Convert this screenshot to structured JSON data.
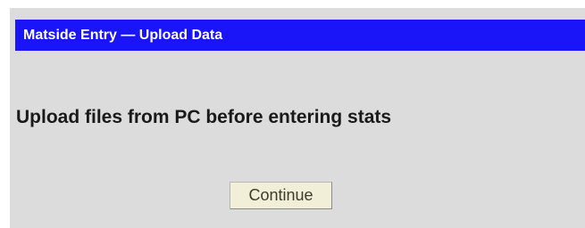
{
  "header": {
    "title": "Matside Entry — Upload Data"
  },
  "main": {
    "message": "Upload files from PC before entering stats",
    "continue_label": "Continue"
  },
  "colors": {
    "title_bar_background": "#1a14f8",
    "panel_background": "#dcdcdc",
    "button_background": "#f1efd8"
  }
}
